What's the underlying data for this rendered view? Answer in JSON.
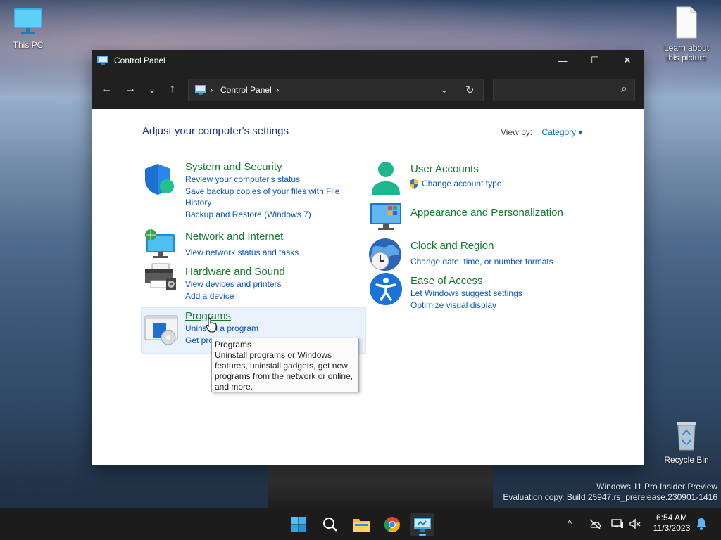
{
  "desktop": {
    "icons": {
      "this_pc": "This PC",
      "learn_picture": "Learn about this picture",
      "recycle_bin": "Recycle Bin"
    },
    "watermark": {
      "line1": "Windows 11 Pro Insider Preview",
      "line2": "Evaluation copy. Build 25947.rs_prerelease.230901-1416"
    }
  },
  "window": {
    "title": "Control Panel",
    "controls": {
      "minimize": "—",
      "maximize": "☐",
      "close": "✕"
    },
    "nav": {
      "back": "←",
      "forward": "→",
      "recent": "⌄",
      "up": "↑",
      "dropdown": "⌄",
      "refresh": "↻"
    },
    "address": {
      "sep1": "›",
      "crumb": "Control Panel",
      "sep2": "›"
    },
    "search": {
      "placeholder": "",
      "icon": "⌕"
    }
  },
  "content": {
    "heading": "Adjust your computer's settings",
    "view_by": {
      "label": "View by:",
      "value": "Category",
      "caret": "▾"
    },
    "categories": [
      {
        "title": "System and Security",
        "links": [
          "Review your computer's status",
          "Save backup copies of your files with File History",
          "Backup and Restore (Windows 7)"
        ]
      },
      {
        "title": "Network and Internet",
        "links": [
          "View network status and tasks"
        ]
      },
      {
        "title": "Hardware and Sound",
        "links": [
          "View devices and printers",
          "Add a device"
        ]
      },
      {
        "title": "Programs",
        "links": [
          "Uninstall a program",
          "Get programs"
        ]
      },
      {
        "title": "User Accounts",
        "links": [
          "Change account type"
        ]
      },
      {
        "title": "Appearance and Personalization",
        "links": []
      },
      {
        "title": "Clock and Region",
        "links": [
          "Change date, time, or number formats"
        ]
      },
      {
        "title": "Ease of Access",
        "links": [
          "Let Windows suggest settings",
          "Optimize visual display"
        ]
      }
    ],
    "tooltip": {
      "title": "Programs",
      "body": "Uninstall programs or Windows features, uninstall gadgets, get new programs from the network or online, and more."
    }
  },
  "taskbar": {
    "apps": [
      "start-icon",
      "search-icon",
      "file-explorer-icon",
      "chrome-icon",
      "control-panel-icon"
    ],
    "tray": {
      "chevron": "^"
    },
    "clock": {
      "time": "6:54 AM",
      "date": "11/3/2023"
    }
  },
  "colors": {
    "accent": "#0a56c2",
    "category_title": "#127a2c",
    "heading": "#1e3287",
    "titlebar": "#202020"
  }
}
